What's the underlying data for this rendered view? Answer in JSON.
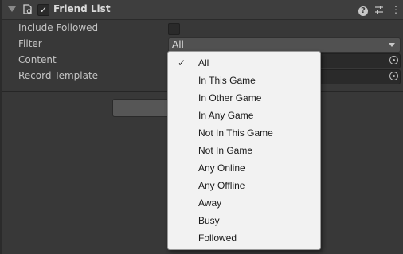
{
  "component": {
    "title": "Friend List",
    "enabled": true
  },
  "fields": {
    "include_followed_label": "Include Followed",
    "filter_label": "Filter",
    "filter_value": "All",
    "content_label": "Content",
    "record_template_label": "Record Template"
  },
  "filter_menu": {
    "selected": "All",
    "items": [
      "All",
      "In This Game",
      "In Other Game",
      "In Any Game",
      "Not In This Game",
      "Not In Game",
      "Any Online",
      "Any Offline",
      "Away",
      "Busy",
      "Followed"
    ]
  },
  "icons": {
    "foldout": "foldout-arrow-icon",
    "component": "script-component-icon",
    "help": "help-icon",
    "preset": "preset-sliders-icon",
    "menu": "kebab-menu-icon",
    "object_picker": "object-picker-target-icon",
    "check": "checkmark-icon"
  },
  "glyphs": {
    "checkmark": "✓",
    "question": "?",
    "preset": "⇅",
    "menu": "⋮"
  }
}
